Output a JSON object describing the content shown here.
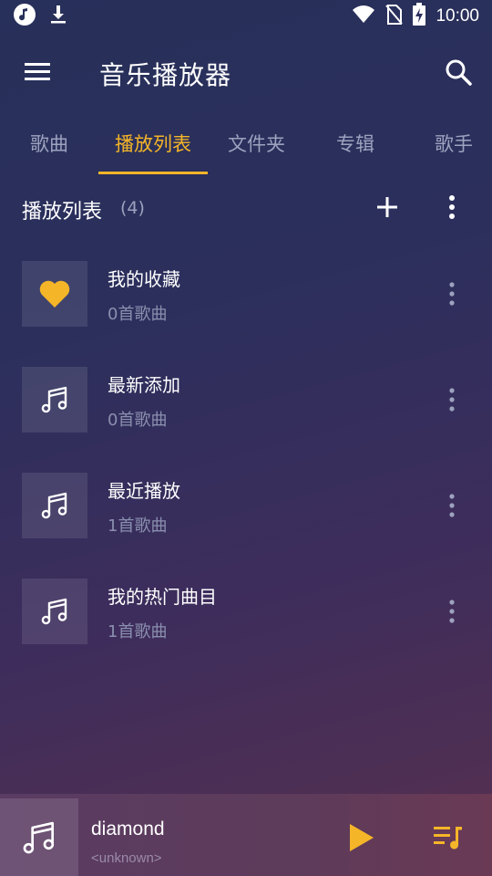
{
  "status_bar": {
    "time": "10:00",
    "left_icons": [
      "music-note-icon",
      "download-icon"
    ],
    "right_icons": [
      "wifi-icon",
      "no-sim-icon",
      "battery-charging-icon"
    ]
  },
  "app_bar": {
    "title": "音乐播放器",
    "menu_icon": "menu-icon",
    "search_icon": "search-icon"
  },
  "tabs": [
    {
      "label": "歌曲",
      "active": false
    },
    {
      "label": "播放列表",
      "active": true
    },
    {
      "label": "文件夹",
      "active": false
    },
    {
      "label": "专辑",
      "active": false
    },
    {
      "label": "歌手",
      "active": false
    }
  ],
  "section": {
    "title": "播放列表",
    "count": "(4)"
  },
  "playlists": [
    {
      "title": "我的收藏",
      "subtitle": "0首歌曲",
      "icon": "heart-icon"
    },
    {
      "title": "最新添加",
      "subtitle": "0首歌曲",
      "icon": "music-note-icon"
    },
    {
      "title": "最近播放",
      "subtitle": "1首歌曲",
      "icon": "music-note-icon"
    },
    {
      "title": "我的热门曲目",
      "subtitle": "1首歌曲",
      "icon": "music-note-icon"
    }
  ],
  "now_playing": {
    "title": "diamond",
    "artist": "<unknown>"
  },
  "colors": {
    "accent": "#f5b528",
    "tab_inactive": "#9da2bf",
    "subtitle": "#8a8fae"
  }
}
